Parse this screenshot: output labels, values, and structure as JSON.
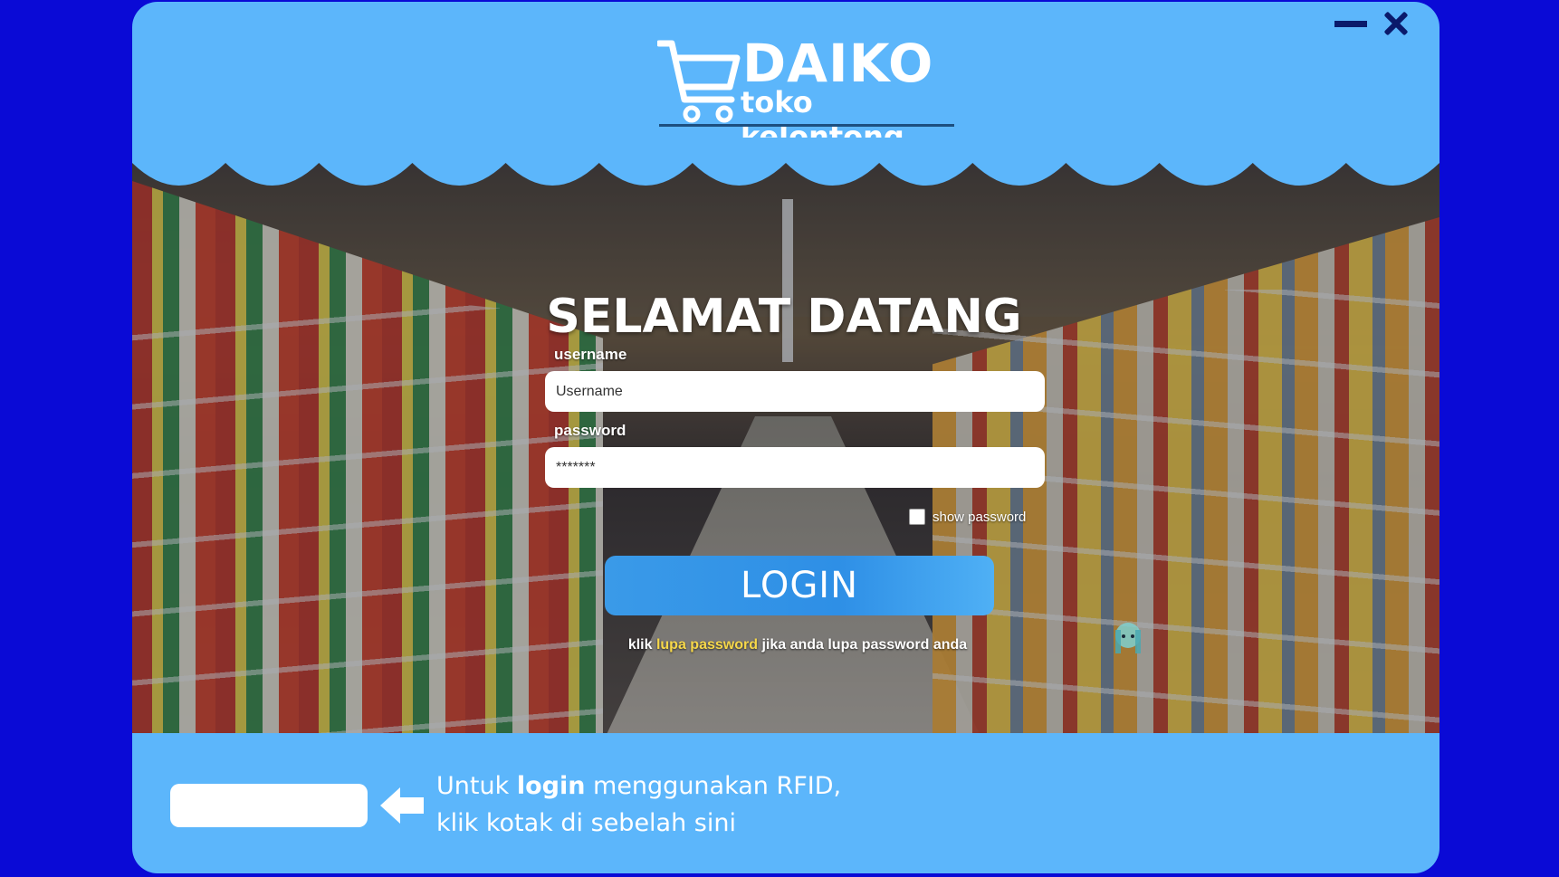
{
  "window": {
    "minimize_icon": "minimize-icon",
    "close_icon": "close-icon"
  },
  "logo": {
    "title": "DAIKO",
    "subtitle": "toko kelontong",
    "icon": "shopping-cart-icon"
  },
  "login": {
    "heading": "SELAMAT DATANG",
    "username_label": "username",
    "username_placeholder": "Username",
    "password_label": "password",
    "password_value": "*******",
    "show_password_label": "show password",
    "login_button": "LOGIN",
    "forgot_prefix": "klik",
    "forgot_link": "lupa password",
    "forgot_suffix": "jika anda lupa password anda"
  },
  "rfid": {
    "line1_prefix": "Untuk",
    "line1_bold": "login",
    "line1_suffix": "menggunakan RFID,",
    "line2": "klik kotak di sebelah sini",
    "arrow_icon": "arrow-left-icon"
  },
  "colors": {
    "page_background": "#0a0ad6",
    "window_background": "#5cb6fb",
    "button": "#2e8fe6",
    "link": "#f7d84a"
  }
}
